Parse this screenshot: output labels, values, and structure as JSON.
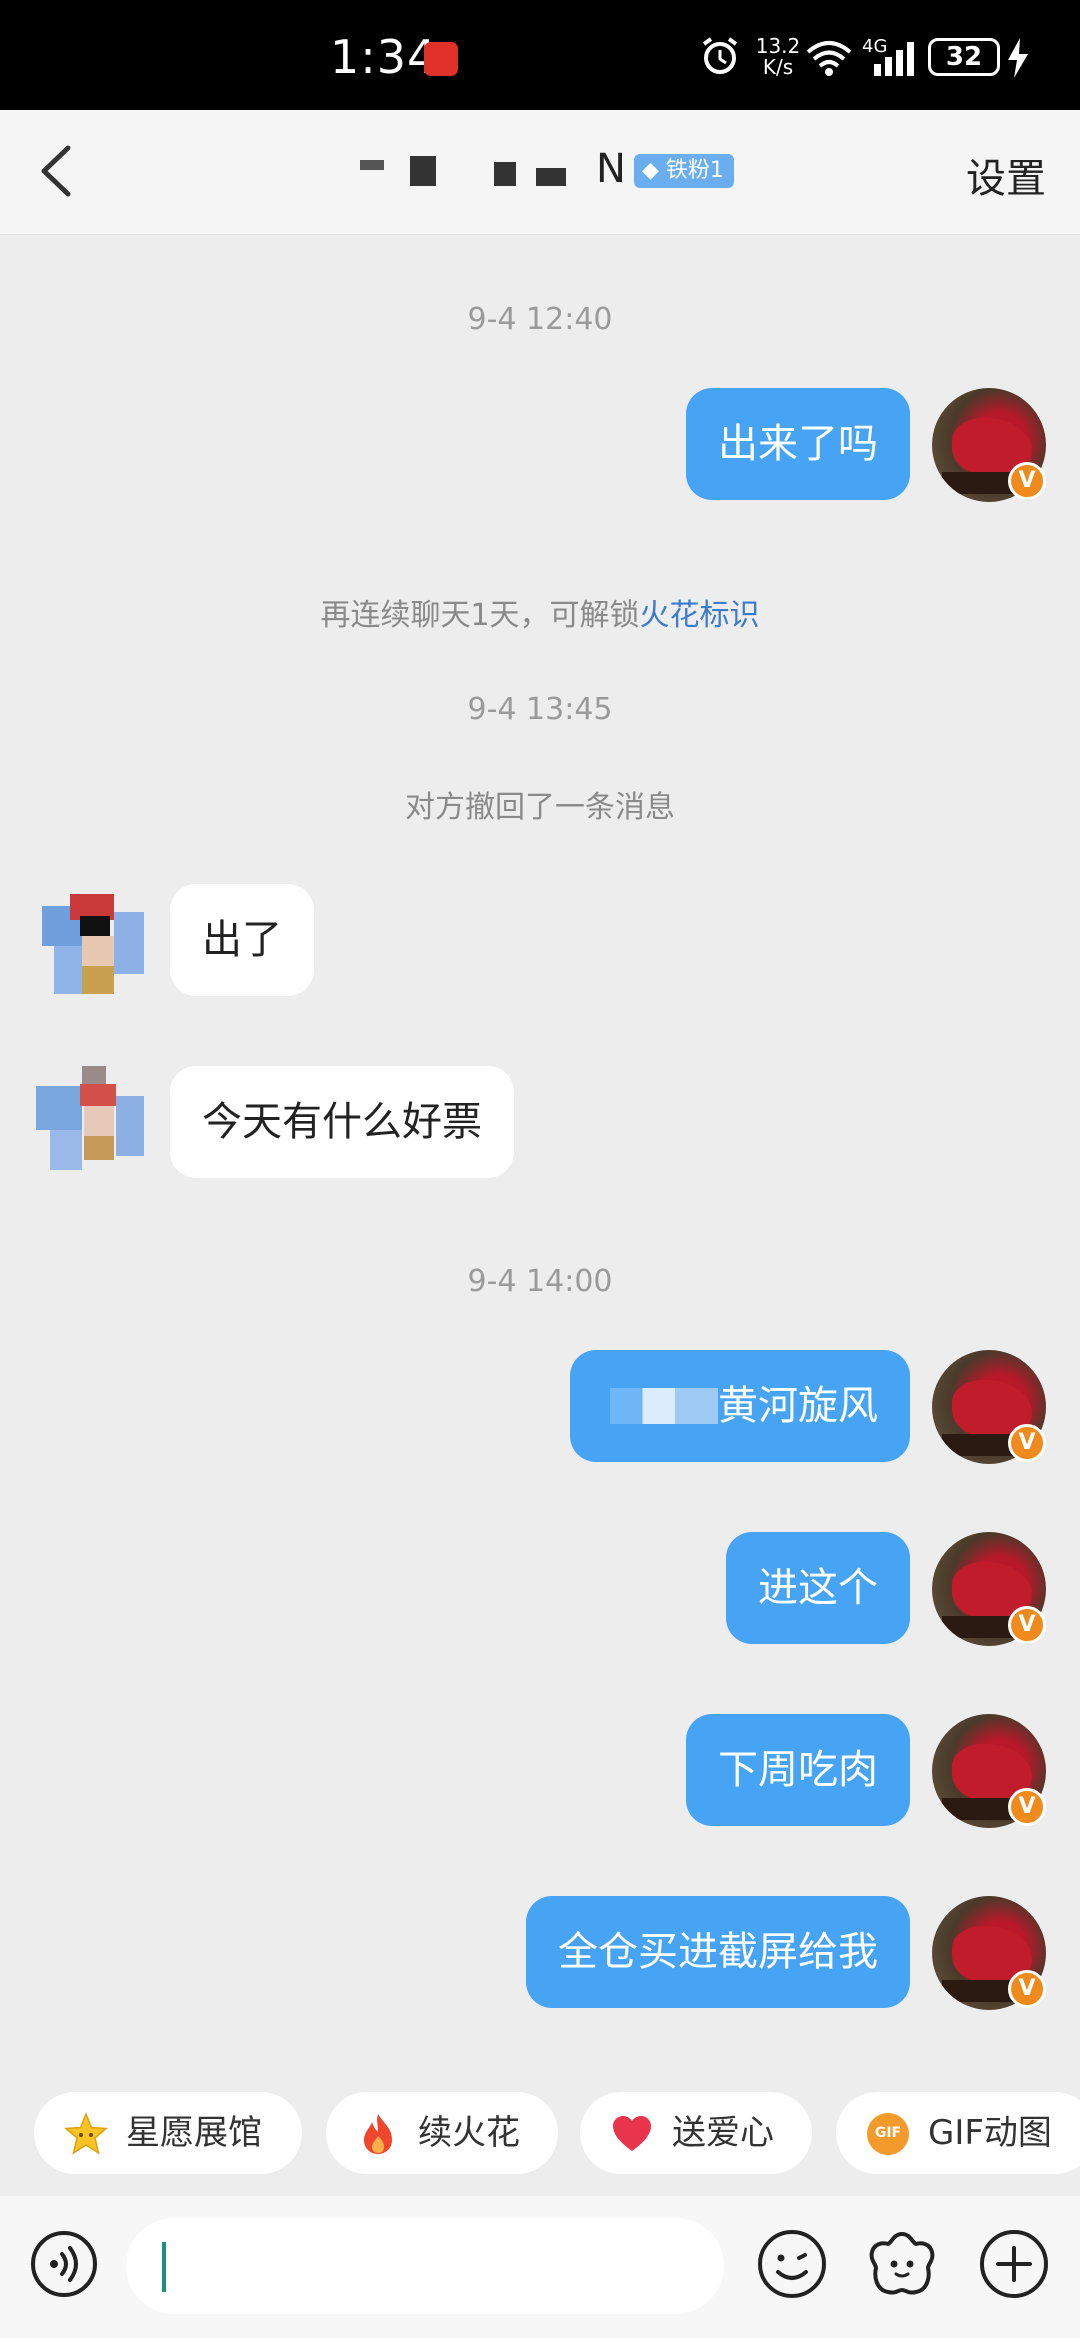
{
  "status_bar": {
    "time": "1:34",
    "net_speed": "13.2",
    "net_speed_unit": "K/s",
    "network": "4G",
    "battery": "32"
  },
  "header": {
    "contact_name_visible": "N",
    "fan_badge": "铁粉1",
    "settings_label": "设置"
  },
  "messages": [
    {
      "type": "timestamp",
      "text": "9-4 12:40"
    },
    {
      "type": "outgoing",
      "text": "出来了吗"
    },
    {
      "type": "system",
      "text": "再连续聊天1天，可解锁",
      "link": "火花标识"
    },
    {
      "type": "timestamp",
      "text": "9-4 13:45"
    },
    {
      "type": "system",
      "text": "对方撤回了一条消息"
    },
    {
      "type": "incoming",
      "text": "出了"
    },
    {
      "type": "incoming",
      "text": "今天有什么好票"
    },
    {
      "type": "timestamp",
      "text": "9-4 14:00"
    },
    {
      "type": "outgoing",
      "text": "黄河旋风"
    },
    {
      "type": "outgoing",
      "text": "进这个"
    },
    {
      "type": "outgoing",
      "text": "下周吃肉"
    },
    {
      "type": "outgoing",
      "text": "全仓买进截屏给我"
    }
  ],
  "avatar_badge": "V",
  "quick_actions": [
    {
      "label": "星愿展馆",
      "icon": "star-icon"
    },
    {
      "label": "续火花",
      "icon": "fire-icon"
    },
    {
      "label": "送爱心",
      "icon": "heart-icon"
    },
    {
      "label": "GIF动图",
      "icon": "gif-icon"
    }
  ],
  "gif_icon_text": "GIF",
  "colors": {
    "outgoing_bubble": "#47a4f4",
    "incoming_bubble": "#ffffff",
    "background": "#ededed",
    "link": "#3d7bd0",
    "badge": "#f08a1c"
  }
}
